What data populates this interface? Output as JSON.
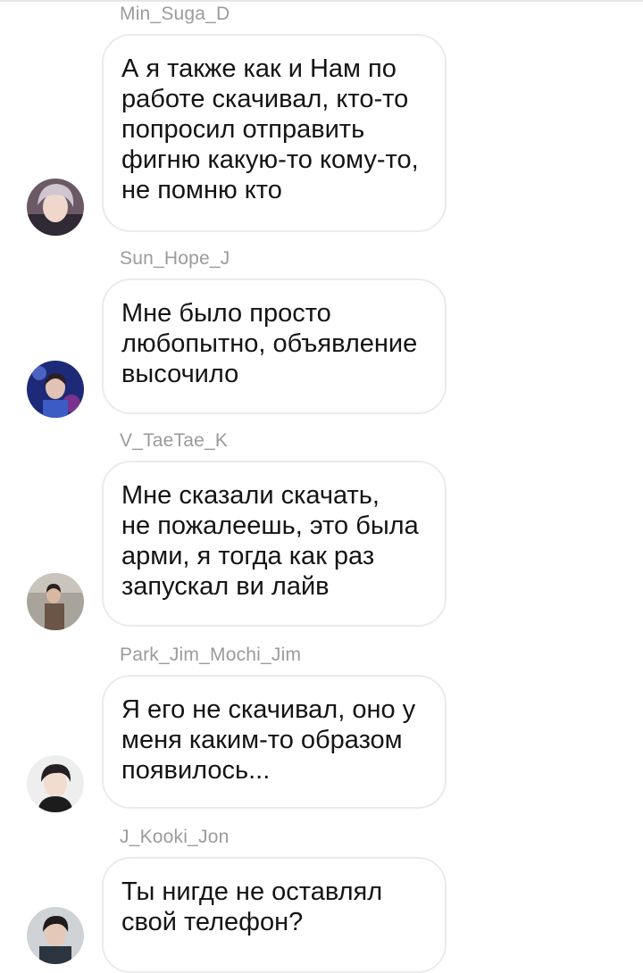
{
  "messages": [
    {
      "author": "Min_Suga_D",
      "lines": [
        "А я также как и Нам по",
        "работе скачивал, кто-то",
        "попросил отправить",
        "фигню какую-то кому-то,",
        "не помню кто"
      ]
    },
    {
      "author": "Sun_Hope_J",
      "lines": [
        "Мне было просто",
        "любопытно, объявление",
        "высочило"
      ]
    },
    {
      "author": "V_TaeTae_K",
      "lines": [
        "Мне сказали скачать,",
        "не пожалеешь, это была",
        "арми, я тогда как раз",
        "запускал ви лайв"
      ]
    },
    {
      "author": "Park_Jim_Mochi_Jim",
      "lines": [
        "Я его не скачивал, оно у",
        "меня каким-то образом",
        "появилось..."
      ]
    },
    {
      "author": "J_Kooki_Jon",
      "lines": [
        "Ты нигде не оставлял",
        "свой телефон?"
      ]
    }
  ],
  "colors": {
    "background": "#ffffff",
    "bubble_border": "#ebebeb",
    "author_name": "#9b9b9b",
    "message_text": "#141414"
  }
}
